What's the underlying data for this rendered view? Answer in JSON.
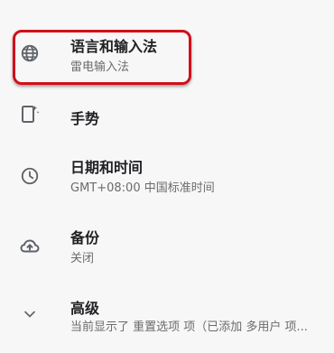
{
  "partial_top": {
    "text": "手势"
  },
  "settings": {
    "items": [
      {
        "title": "语言和输入法",
        "subtitle": "雷电输入法",
        "icon": "globe-icon"
      },
      {
        "title": "手势",
        "subtitle": "",
        "icon": "gesture-phone-icon"
      },
      {
        "title": "日期和时间",
        "subtitle": "GMT+08:00 中国标准时间",
        "icon": "clock-icon"
      },
      {
        "title": "备份",
        "subtitle": "关闭",
        "icon": "cloud-upload-icon"
      },
      {
        "title": "高级",
        "subtitle": "当前显示了 重置选项 项（已添加 多用户 项...",
        "icon": "chevron-down-icon"
      }
    ]
  },
  "colors": {
    "highlight": "#d10f1a",
    "background": "#f7f7f7",
    "primary_text": "#202124",
    "secondary_text": "#6b6b6b"
  }
}
